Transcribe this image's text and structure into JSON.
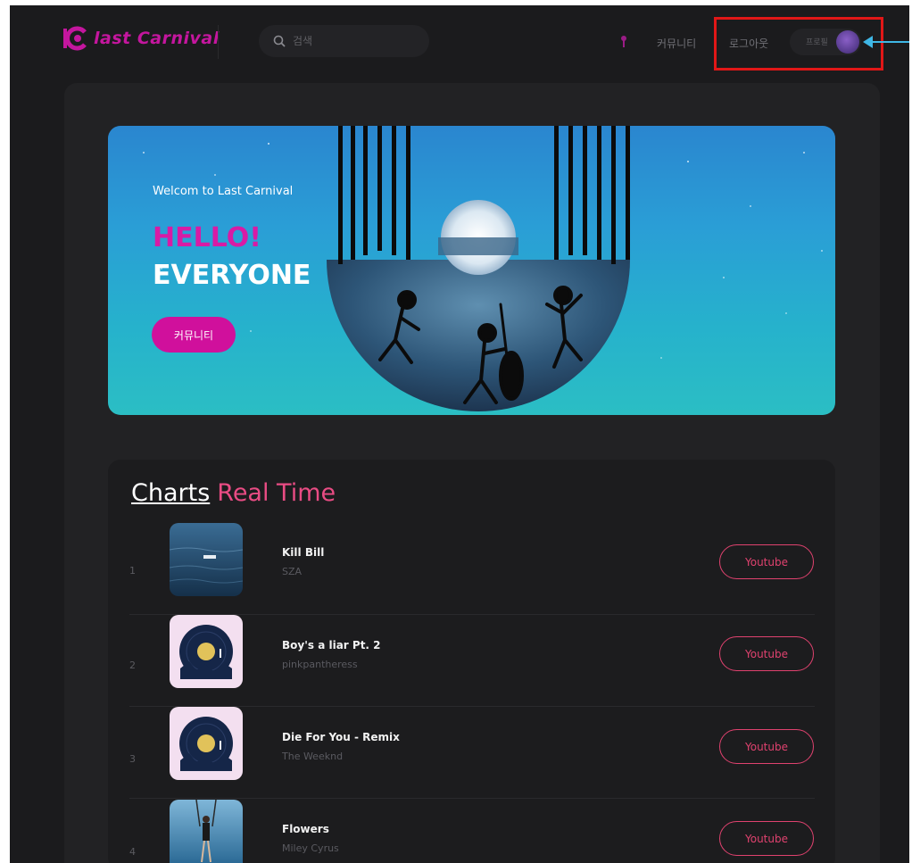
{
  "brand": {
    "logo_text": "last Carnival",
    "accent": "#c4169e"
  },
  "header": {
    "search_placeholder": "검색",
    "nav_community": "커뮤니티",
    "nav_logout": "로그아웃",
    "profile_label": "프로필"
  },
  "hero": {
    "subtitle": "Welcom to Last Carnival",
    "hello": "HELLO!",
    "everyone": "EVERYONE",
    "button_label": "커뮤니티"
  },
  "charts": {
    "title_part1": "Charts",
    "title_part2": "Real Time",
    "button_label": "Youtube",
    "songs": [
      {
        "rank": "1",
        "title": "Kill Bill",
        "artist": "SZA",
        "cover": "ocean"
      },
      {
        "rank": "2",
        "title": "Boy's a liar Pt. 2",
        "artist": "pinkpantheress",
        "cover": "vinyl-moon"
      },
      {
        "rank": "3",
        "title": "Die For You - Remix",
        "artist": "The Weeknd",
        "cover": "vinyl-moon"
      },
      {
        "rank": "4",
        "title": "Flowers",
        "artist": "Miley Cyrus",
        "cover": "swing"
      }
    ]
  }
}
